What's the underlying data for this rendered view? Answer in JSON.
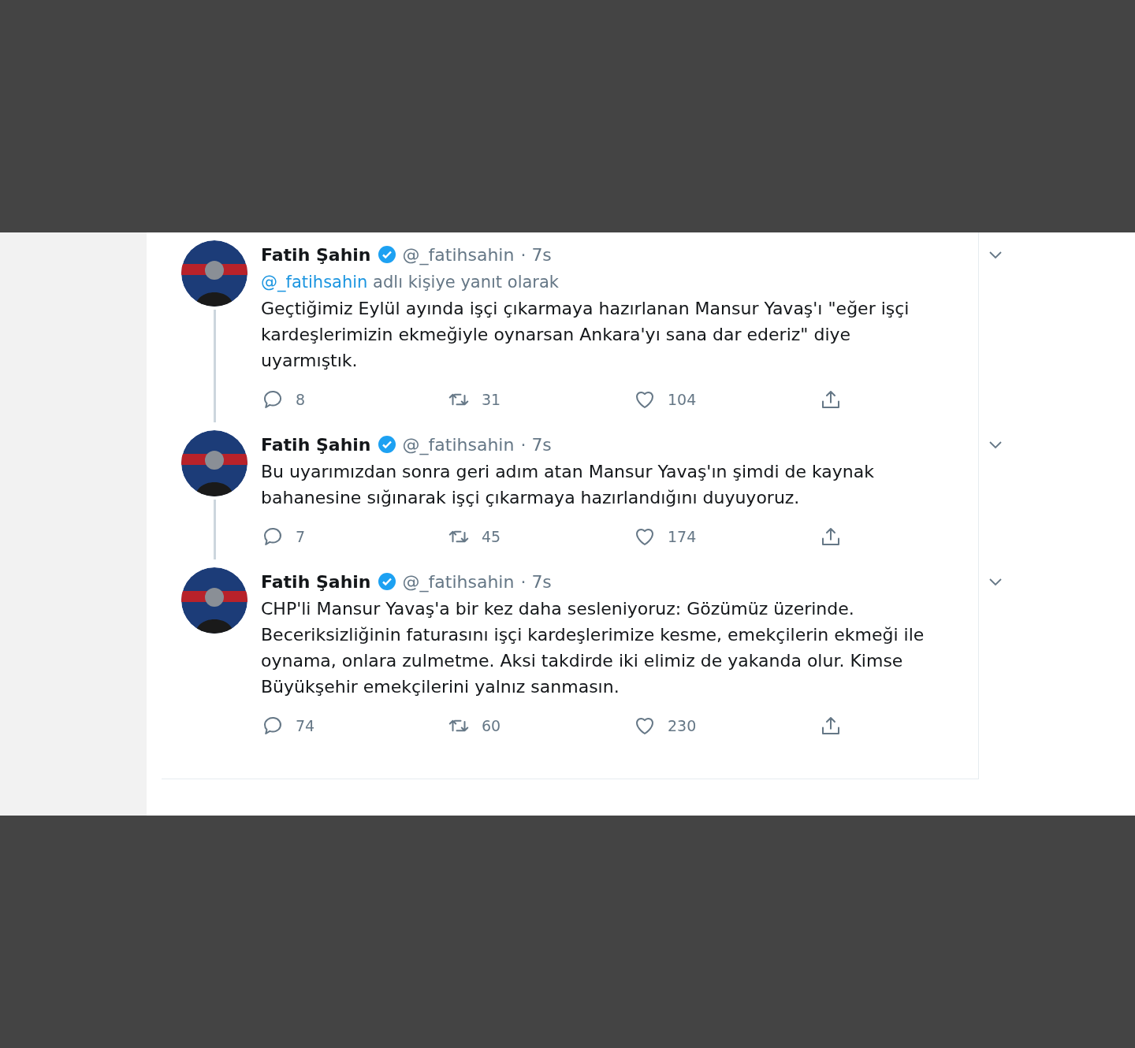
{
  "tweets": [
    {
      "name": "Fatih Şahin",
      "handle": "@_fatihsahin",
      "time": "· 7s",
      "reply_to": {
        "handle": "@_fatihsahin",
        "text": "adlı kişiye yanıt olarak"
      },
      "text": "Geçtiğimiz Eylül ayında işçi çıkarmaya hazırlanan Mansur Yavaş'ı \"eğer işçi kardeşlerimizin ekmeğiyle oynarsan Ankara'yı sana dar ederiz\" diye uyarmıştık.",
      "replies": "8",
      "retweets": "31",
      "likes": "104"
    },
    {
      "name": "Fatih Şahin",
      "handle": "@_fatihsahin",
      "time": "· 7s",
      "text": "Bu uyarımızdan sonra geri adım atan Mansur Yavaş'ın şimdi de kaynak bahanesine sığınarak işçi çıkarmaya hazırlandığını duyuyoruz.",
      "replies": "7",
      "retweets": "45",
      "likes": "174"
    },
    {
      "name": "Fatih Şahin",
      "handle": "@_fatihsahin",
      "time": "· 7s",
      "text": "CHP'li Mansur Yavaş'a bir kez daha sesleniyoruz: Gözümüz üzerinde. Beceriksizliğinin faturasını işçi kardeşlerimize kesme, emekçilerin ekmeği ile oynama, onlara zulmetme. Aksi takdirde iki elimiz de yakanda olur. Kimse Büyükşehir emekçilerini yalnız sanmasın.",
      "replies": "74",
      "retweets": "60",
      "likes": "230"
    }
  ]
}
